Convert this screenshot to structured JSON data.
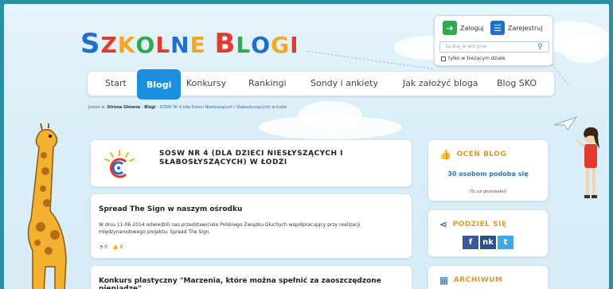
{
  "logo": {
    "letters": [
      "S",
      "Z",
      "K",
      "O",
      "L",
      "N",
      "E",
      " ",
      "B",
      "L",
      "O",
      "G",
      "I"
    ],
    "colors": [
      "#1f6fd1",
      "#e23b2e",
      "#f5a623",
      "#2fa84f",
      "#e23b2e",
      "#1f6fd1",
      "#f5a623",
      "#ffffff",
      "#e23b2e",
      "#2fa84f",
      "#1f6fd1",
      "#f5a623",
      "#e23b2e"
    ]
  },
  "login_box": {
    "login_label": "Zaloguj",
    "register_label": "Zarejestruj",
    "search_placeholder": "Szukaj w witrynie",
    "checkbox_label": "tylko w bieżącym dziale"
  },
  "nav": {
    "items": [
      "Start",
      "Blogi",
      "Konkursy",
      "Rankingi",
      "Sondy i ankiety",
      "Jak założyć bloga",
      "Blog SKO"
    ],
    "active_index": 1
  },
  "breadcrumb": {
    "prefix": "Jesteś w:",
    "home": "Strona Główna",
    "sep": "›",
    "blogs": "Blogi",
    "current": "SOSW Nr 4 (dla Dzieci Niesłyszących i Słabosłyszących) w Łodzi"
  },
  "school": {
    "title": "SOSW NR 4 (DLA DZIECI NIESŁYSZĄCYCH I SŁABOSŁYSZĄCYCH) W ŁODZI"
  },
  "posts": [
    {
      "title": "Spread The Sign w naszym ośrodku",
      "body": "W dniu 11-06-2014 odwiedzili nas przedstawiciele Polskiego Związku Głuchych współpracujący przy realizacji międzynarodowego projektu: Spread The Sign.",
      "comments": "0",
      "likes": "0"
    },
    {
      "title": "Konkurs plastyczny \"Marzenia, które można spełnić za zaoszczędzone pieniądze\"."
    }
  ],
  "sidebar": {
    "rate_title": "OCEŃ BLOG",
    "rate_likes": "30 osobom podoba się",
    "rate_note": "(Ty już głosowałeś)",
    "share_title": "PODZIEL SIĘ",
    "share_buttons": [
      "f",
      "nk",
      "t"
    ],
    "archive_title": "ARCHIWUM"
  },
  "colors": {
    "accent": "#1d8fe0",
    "orange": "#e0982a",
    "facebook": "#3b5998",
    "nk": "#2f4f87",
    "twitter": "#3fa8e0"
  }
}
